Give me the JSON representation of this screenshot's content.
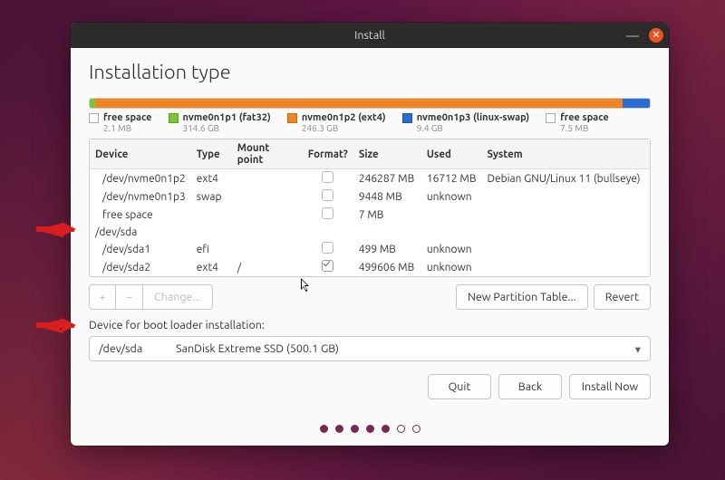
{
  "window": {
    "title": "Install"
  },
  "page": {
    "heading": "Installation type"
  },
  "legend": [
    {
      "color": "#ffffff",
      "border": "#aaa",
      "title": "free space",
      "sub": "2.1 MB"
    },
    {
      "color": "#7cc534",
      "border": "#5aa11c",
      "title": "nvme0n1p1 (fat32)",
      "sub": "314.6 GB"
    },
    {
      "color": "#f08422",
      "border": "#cf6a0f",
      "title": "nvme0n1p2 (ext4)",
      "sub": "246.3 GB"
    },
    {
      "color": "#2a6dd0",
      "border": "#1e54a6",
      "title": "nvme0n1p3 (linux-swap)",
      "sub": "9.4 GB"
    },
    {
      "color": "#ffffff",
      "border": "#aaa",
      "title": "free space",
      "sub": "7.5 MB"
    }
  ],
  "usage_segments": [
    {
      "color": "#7cc534",
      "pct": 1
    },
    {
      "color": "#f08422",
      "pct": 94.1
    },
    {
      "color": "#2a6dd0",
      "pct": 4.9
    }
  ],
  "table": {
    "headers": [
      "Device",
      "Type",
      "Mount point",
      "Format?",
      "Size",
      "Used",
      "System"
    ],
    "rows": [
      {
        "device": "/dev/nvme0n1p2",
        "indent": true,
        "type": "ext4",
        "mount": "",
        "format": false,
        "size": "246287 MB",
        "used": "16712 MB",
        "system": "Debian GNU/Linux 11 (bullseye)"
      },
      {
        "device": "/dev/nvme0n1p3",
        "indent": true,
        "type": "swap",
        "mount": "",
        "format": false,
        "size": "9448 MB",
        "used": "unknown",
        "system": ""
      },
      {
        "device": "free space",
        "indent": true,
        "type": "",
        "mount": "",
        "format": false,
        "size": "7 MB",
        "used": "",
        "system": ""
      },
      {
        "device": "/dev/sda",
        "indent": false,
        "header_row": true
      },
      {
        "device": "/dev/sda1",
        "indent": true,
        "type": "efi",
        "mount": "",
        "format": false,
        "size": "499 MB",
        "used": "unknown",
        "system": ""
      },
      {
        "device": "/dev/sda2",
        "indent": true,
        "type": "ext4",
        "mount": "/",
        "format": true,
        "size": "499606 MB",
        "used": "unknown",
        "system": ""
      }
    ]
  },
  "toolbar": {
    "plus": "+",
    "minus": "−",
    "change": "Change...",
    "new_pt": "New Partition Table...",
    "revert": "Revert"
  },
  "bootloader": {
    "label": "Device for boot loader installation:",
    "device": "/dev/sda",
    "desc": "SanDisk Extreme SSD (500.1 GB)"
  },
  "footer": {
    "quit": "Quit",
    "back": "Back",
    "install": "Install Now"
  },
  "progress_dots": {
    "total": 7,
    "current": 5
  }
}
